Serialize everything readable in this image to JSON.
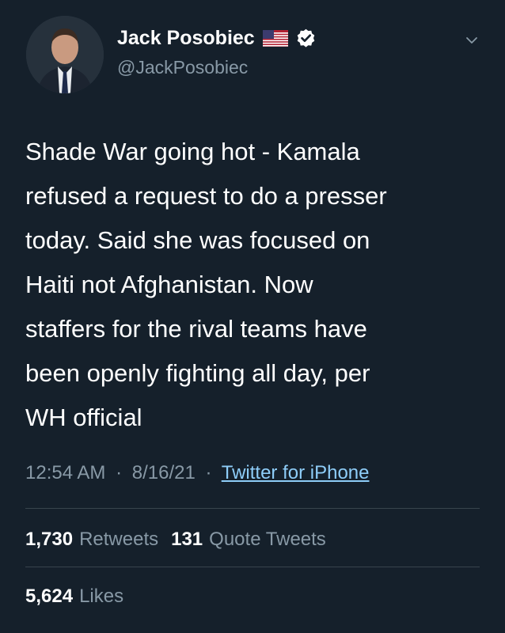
{
  "author": {
    "display_name": "Jack Posobiec",
    "handle": "@JackPosobiec",
    "flag_icon": "us-flag-icon",
    "verified_icon": "verified-badge-icon"
  },
  "menu_icon": "chevron-down-icon",
  "tweet": {
    "text": "Shade War going hot - Kamala\nrefused a request to do a presser\ntoday. Said she was focused on\nHaiti not Afghanistan. Now\nstaffers for the rival teams have\nbeen openly fighting all day, per\nWH official",
    "time": "12:54 AM",
    "separator": "·",
    "date": "8/16/21",
    "source": "Twitter for iPhone"
  },
  "stats": {
    "retweets_count": "1,730",
    "retweets_label": "Retweets",
    "quote_count": "131",
    "quote_label": "Quote Tweets",
    "likes_count": "5,624",
    "likes_label": "Likes"
  },
  "colors": {
    "background": "#15202b",
    "secondary_text": "#8899a6",
    "link": "#8ecdf8",
    "divider": "#38444d"
  }
}
